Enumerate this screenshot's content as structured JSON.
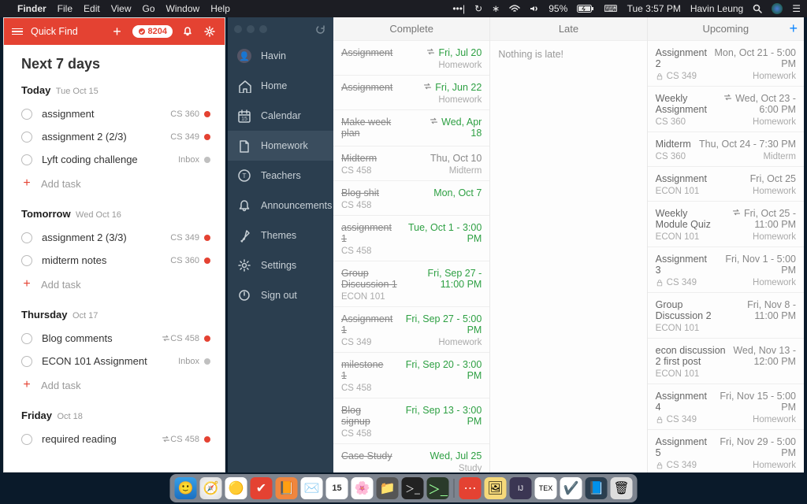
{
  "menubar": {
    "app": "Finder",
    "items": [
      "File",
      "Edit",
      "View",
      "Go",
      "Window",
      "Help"
    ],
    "battery": "95%",
    "time": "Tue 3:57 PM",
    "user": "Havin Leung"
  },
  "todoist": {
    "quick_find": "Quick Find",
    "karma": "8204",
    "title": "Next 7 days",
    "days": [
      {
        "label": "Today",
        "sub": "Tue Oct 15",
        "tasks": [
          {
            "title": "assignment",
            "tag": "CS 360",
            "dot": "#e44232"
          },
          {
            "title": "assignment 2 (2/3)",
            "tag": "CS 349",
            "dot": "#e44232"
          },
          {
            "title": "Lyft coding challenge",
            "tag": "Inbox",
            "dot": "#c0c0c0"
          }
        ],
        "add": "Add task"
      },
      {
        "label": "Tomorrow",
        "sub": "Wed Oct 16",
        "tasks": [
          {
            "title": "assignment 2 (3/3)",
            "tag": "CS 349",
            "dot": "#e44232"
          },
          {
            "title": "midterm notes",
            "tag": "CS 360",
            "dot": "#e44232"
          }
        ],
        "add": "Add task"
      },
      {
        "label": "Thursday",
        "sub": "Oct 17",
        "tasks": [
          {
            "title": "Blog comments",
            "tag": "CS 458",
            "dot": "#e44232",
            "recur": true
          },
          {
            "title": "ECON 101 Assignment",
            "tag": "Inbox",
            "dot": "#c0c0c0"
          }
        ],
        "add": "Add task"
      },
      {
        "label": "Friday",
        "sub": "Oct 18",
        "tasks": [
          {
            "title": "required reading",
            "tag": "CS 458",
            "dot": "#e44232",
            "recur": true
          }
        ]
      }
    ]
  },
  "sidebar": {
    "user": "Havin",
    "items": [
      {
        "label": "Home",
        "icon": "home"
      },
      {
        "label": "Calendar",
        "icon": "calendar"
      },
      {
        "label": "Homework",
        "icon": "homework",
        "active": true
      },
      {
        "label": "Teachers",
        "icon": "teachers"
      },
      {
        "label": "Announcements",
        "icon": "bell"
      },
      {
        "label": "Themes",
        "icon": "brush"
      },
      {
        "label": "Settings",
        "icon": "gear"
      },
      {
        "label": "Sign out",
        "icon": "power"
      }
    ]
  },
  "columns": {
    "complete": {
      "title": "Complete",
      "items": [
        {
          "title": "Assignment",
          "date": "Fri, Jul 20",
          "color": "green",
          "sub": "",
          "type": "Homework",
          "done": true,
          "recur": true
        },
        {
          "title": "Assignment",
          "date": "Fri, Jun 22",
          "color": "green",
          "sub": "",
          "type": "Homework",
          "done": true,
          "recur": true
        },
        {
          "title": "Make week plan",
          "date": "Wed, Apr 18",
          "color": "green",
          "sub": "",
          "type": "",
          "done": true,
          "recur": true
        },
        {
          "title": "Midterm",
          "date": "Thu, Oct 10",
          "color": "gray",
          "sub": "CS 458",
          "type": "Midterm",
          "done": true
        },
        {
          "title": "Blog shit",
          "date": "Mon, Oct 7",
          "color": "green",
          "sub": "CS 458",
          "type": "",
          "done": true
        },
        {
          "title": "assignment 1",
          "date": "Tue, Oct 1 - 3:00 PM",
          "color": "green",
          "sub": "CS 458",
          "type": "",
          "done": true
        },
        {
          "title": "Group Discussion 1",
          "date": "Fri, Sep 27 - 11:00 PM",
          "color": "green",
          "sub": "ECON 101",
          "type": "",
          "done": true
        },
        {
          "title": "Assignment 1",
          "date": "Fri, Sep 27 - 5:00 PM",
          "color": "green",
          "sub": "CS 349",
          "type": "Homework",
          "done": true
        },
        {
          "title": "milestone 1",
          "date": "Fri, Sep 20 - 3:00 PM",
          "color": "green",
          "sub": "CS 458",
          "type": "",
          "done": true
        },
        {
          "title": "Blog signup",
          "date": "Fri, Sep 13 - 3:00 PM",
          "color": "green",
          "sub": "CS 458",
          "type": "",
          "done": true
        },
        {
          "title": "Case Study",
          "date": "Wed, Jul 25",
          "color": "green",
          "sub": "",
          "type": "Study",
          "done": true
        }
      ]
    },
    "late": {
      "title": "Late",
      "empty": "Nothing is late!"
    },
    "upcoming": {
      "title": "Upcoming",
      "items": [
        {
          "title": "Assignment 2",
          "date": "Mon, Oct 21 - 5:00 PM",
          "color": "gray",
          "sub": "CS 349",
          "type": "Homework",
          "lock": true
        },
        {
          "title": "Weekly Assignment",
          "date": "Wed, Oct 23 - 6:00 PM",
          "color": "gray",
          "sub": "CS 360",
          "type": "Homework",
          "recur": true
        },
        {
          "title": "Midterm",
          "date": "Thu, Oct 24 - 7:30 PM",
          "color": "gray",
          "sub": "CS 360",
          "type": "Midterm"
        },
        {
          "title": "Assignment",
          "date": "Fri, Oct 25",
          "color": "gray",
          "sub": "ECON 101",
          "type": "Homework"
        },
        {
          "title": "Weekly Module Quiz",
          "date": "Fri, Oct 25 - 11:00 PM",
          "color": "gray",
          "sub": "ECON 101",
          "type": "Homework",
          "recur": true
        },
        {
          "title": "Assignment 3",
          "date": "Fri, Nov 1 - 5:00 PM",
          "color": "gray",
          "sub": "CS 349",
          "type": "Homework",
          "lock": true
        },
        {
          "title": "Group Discussion 2",
          "date": "Fri, Nov 8 - 11:00 PM",
          "color": "gray",
          "sub": "ECON 101",
          "type": ""
        },
        {
          "title": "econ discussion 2 first post",
          "date": "Wed, Nov 13 - 12:00 PM",
          "color": "gray",
          "sub": "ECON 101",
          "type": ""
        },
        {
          "title": "Assignment 4",
          "date": "Fri, Nov 15 - 5:00 PM",
          "color": "gray",
          "sub": "CS 349",
          "type": "Homework",
          "lock": true
        },
        {
          "title": "Assignment 5",
          "date": "Fri, Nov 29 - 5:00 PM",
          "color": "gray",
          "sub": "CS 349",
          "type": "Homework",
          "lock": true
        }
      ]
    }
  }
}
